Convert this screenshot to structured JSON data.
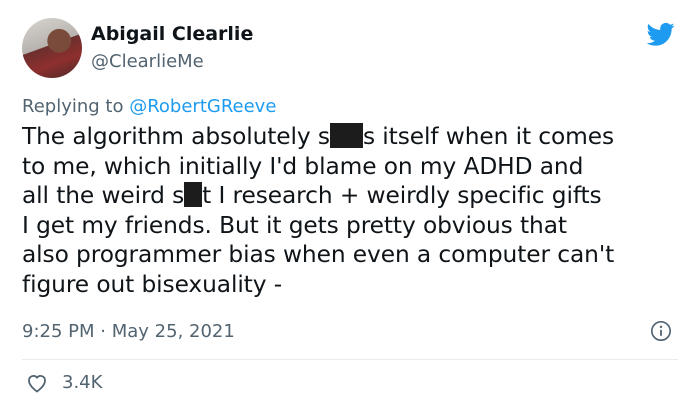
{
  "author": {
    "name": "Abigail Clearlie",
    "handle": "@ClearlieMe"
  },
  "reply": {
    "prefix": "Replying to ",
    "mention": "@RobertGReeve"
  },
  "body": {
    "line1_a": "The algorithm absolutely s",
    "line1_b": "s itself when it comes",
    "line2": "to me, which initially I'd blame on my ADHD and",
    "line3_a": "all the weird s",
    "line3_b": "t I research + weirdly specific gifts",
    "line4": "I get my friends. But it gets pretty obvious that",
    "line5": "also programmer bias when even a computer can't",
    "line6": "figure out bisexuality -"
  },
  "meta": {
    "time": "9:25 PM",
    "separator": "·",
    "date": "May 25, 2021"
  },
  "engagement": {
    "likes": "3.4K"
  },
  "colors": {
    "accent": "#1d9bf0",
    "text": "#0f1419",
    "muted": "#536471"
  },
  "icons": [
    "twitter-bird-icon",
    "info-icon",
    "heart-icon"
  ]
}
